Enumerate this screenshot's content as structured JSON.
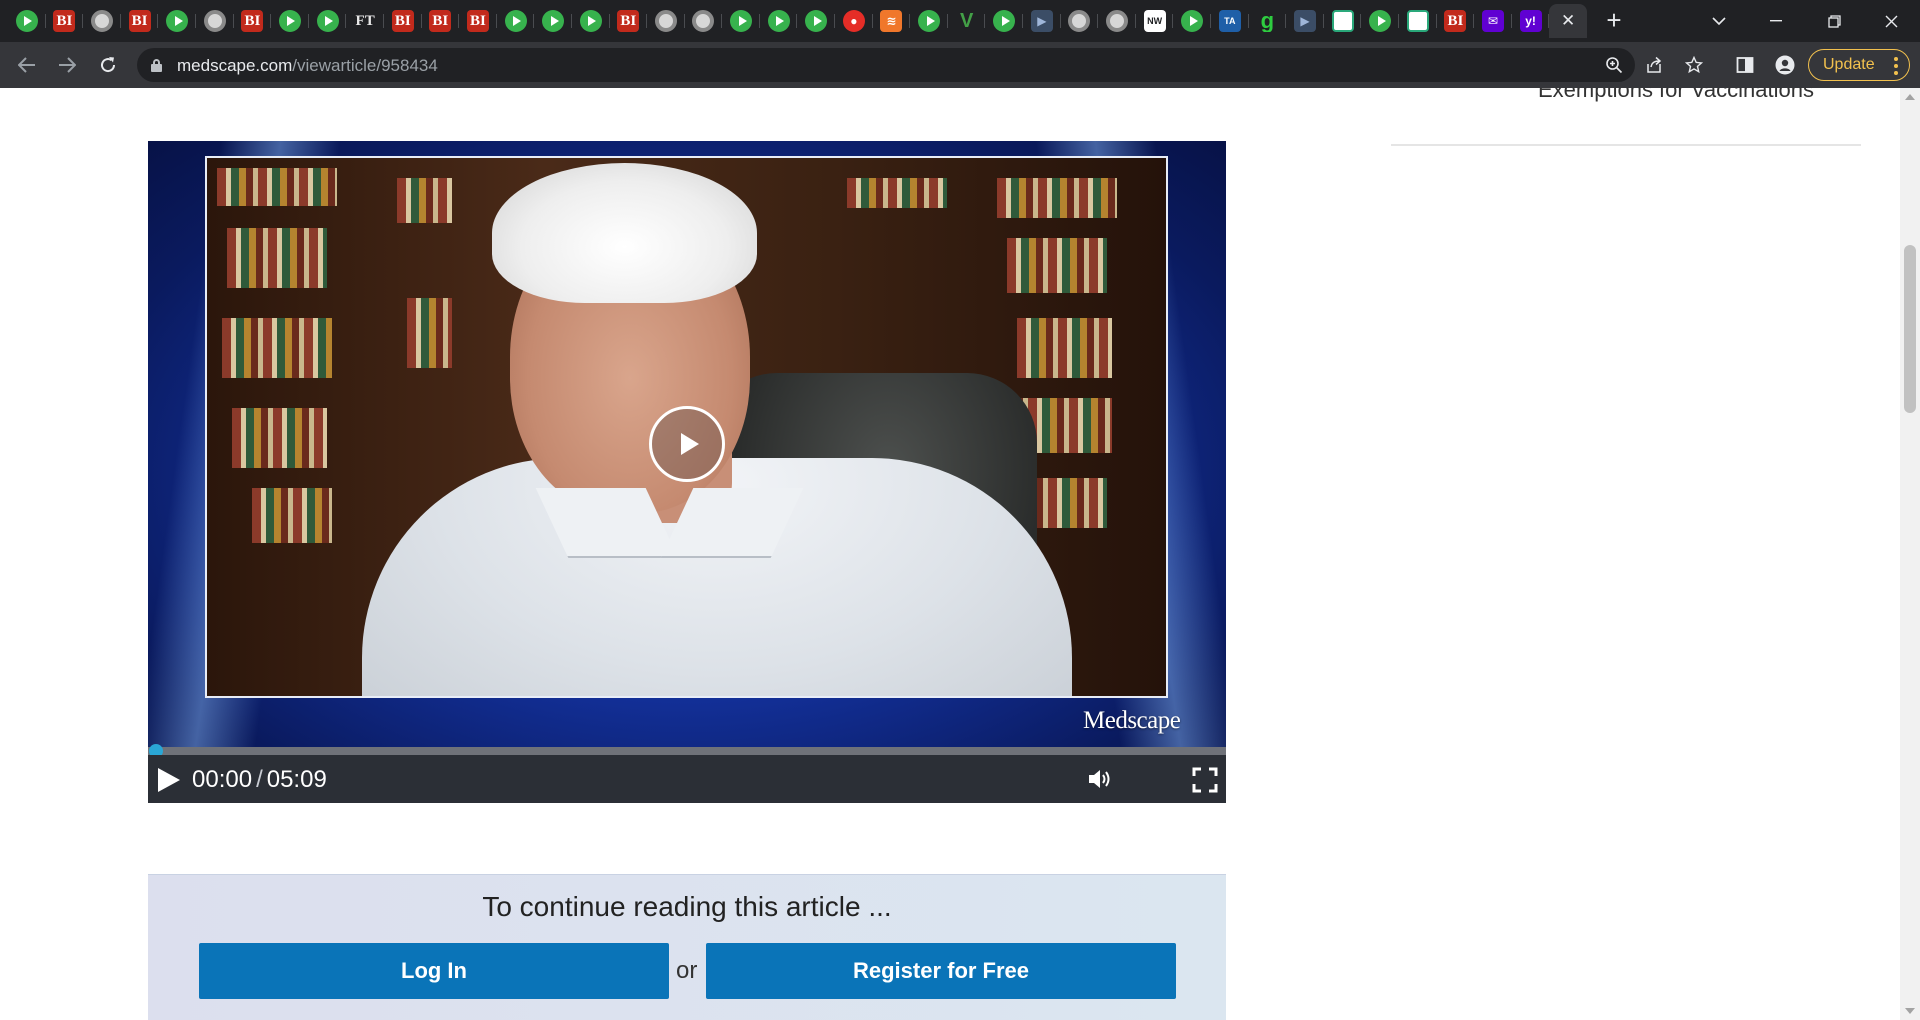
{
  "browser": {
    "tabs": [
      {
        "icon": "play-favicon-icon",
        "kind": "play",
        "text": ""
      },
      {
        "icon": "business-insider-favicon-icon",
        "kind": "bi",
        "text": "BI"
      },
      {
        "icon": "globe-favicon-icon",
        "kind": "globe",
        "text": ""
      },
      {
        "icon": "business-insider-favicon-icon",
        "kind": "bi",
        "text": "BI"
      },
      {
        "icon": "play-favicon-icon",
        "kind": "play",
        "text": ""
      },
      {
        "icon": "globe-favicon-icon",
        "kind": "globe",
        "text": ""
      },
      {
        "icon": "business-insider-favicon-icon",
        "kind": "bi",
        "text": "BI"
      },
      {
        "icon": "play-favicon-icon",
        "kind": "play",
        "text": ""
      },
      {
        "icon": "play-favicon-icon",
        "kind": "play",
        "text": ""
      },
      {
        "icon": "financial-times-favicon-icon",
        "kind": "ft",
        "text": "FT"
      },
      {
        "icon": "business-insider-favicon-icon",
        "kind": "bi",
        "text": "BI"
      },
      {
        "icon": "business-insider-favicon-icon",
        "kind": "bi",
        "text": "BI"
      },
      {
        "icon": "business-insider-favicon-icon",
        "kind": "bi",
        "text": "BI"
      },
      {
        "icon": "play-favicon-icon",
        "kind": "play",
        "text": ""
      },
      {
        "icon": "play-favicon-icon",
        "kind": "play",
        "text": ""
      },
      {
        "icon": "play-favicon-icon",
        "kind": "play",
        "text": ""
      },
      {
        "icon": "business-insider-favicon-icon",
        "kind": "bi",
        "text": "BI"
      },
      {
        "icon": "globe-favicon-icon",
        "kind": "globe",
        "text": ""
      },
      {
        "icon": "globe-favicon-icon",
        "kind": "globe",
        "text": ""
      },
      {
        "icon": "play-favicon-icon",
        "kind": "play",
        "text": ""
      },
      {
        "icon": "play-favicon-icon",
        "kind": "play",
        "text": ""
      },
      {
        "icon": "play-favicon-icon",
        "kind": "play",
        "text": ""
      },
      {
        "icon": "microphone-favicon-icon",
        "kind": "mic",
        "text": "●"
      },
      {
        "icon": "flame-favicon-icon",
        "kind": "flame",
        "text": "≋"
      },
      {
        "icon": "play-favicon-icon",
        "kind": "play",
        "text": ""
      },
      {
        "icon": "checkmark-favicon-icon",
        "kind": "check",
        "text": "V"
      },
      {
        "icon": "play-favicon-icon",
        "kind": "play",
        "text": ""
      },
      {
        "icon": "arrow-favicon-icon",
        "kind": "arrow",
        "text": "▶"
      },
      {
        "icon": "globe-favicon-icon",
        "kind": "globe",
        "text": ""
      },
      {
        "icon": "globe-favicon-icon",
        "kind": "globe",
        "text": ""
      },
      {
        "icon": "newsweek-favicon-icon",
        "kind": "nw",
        "text": "NW"
      },
      {
        "icon": "play-favicon-icon",
        "kind": "play",
        "text": ""
      },
      {
        "icon": "tech-favicon-icon",
        "kind": "ta",
        "text": "TA"
      },
      {
        "icon": "g-favicon-icon",
        "kind": "g",
        "text": "g"
      },
      {
        "icon": "arrow-favicon-icon",
        "kind": "arrow",
        "text": "▶"
      },
      {
        "icon": "grid-favicon-icon",
        "kind": "grid",
        "text": ""
      },
      {
        "icon": "play-favicon-icon",
        "kind": "play",
        "text": ""
      },
      {
        "icon": "grid-favicon-icon",
        "kind": "grid",
        "text": ""
      },
      {
        "icon": "business-insider-favicon-icon",
        "kind": "bi",
        "text": "BI"
      },
      {
        "icon": "mail-favicon-icon",
        "kind": "mail",
        "text": "✉"
      },
      {
        "icon": "yahoo-favicon-icon",
        "kind": "yahoo",
        "text": "y!"
      }
    ],
    "active_tab_close": "✕",
    "new_tab": "+",
    "url_host": "medscape.com",
    "url_path": "/viewarticle/958434",
    "update_label": "Update"
  },
  "sidebar": {
    "link_text": "Exemptions for Vaccinations"
  },
  "video": {
    "watermark": "Medscape",
    "current_time": "00:00",
    "separator": "/",
    "duration": "05:09",
    "progress_fraction": 0.0
  },
  "paywall": {
    "title": "To continue reading this article ...",
    "login_label": "Log In",
    "or_label": "or",
    "register_label": "Register for Free"
  },
  "colors": {
    "chrome_dark": "#202124",
    "toolbar": "#35363a",
    "update_accent": "#f2c14e",
    "button_blue": "#0a74b8",
    "progress_accent": "#2aa7d6"
  }
}
